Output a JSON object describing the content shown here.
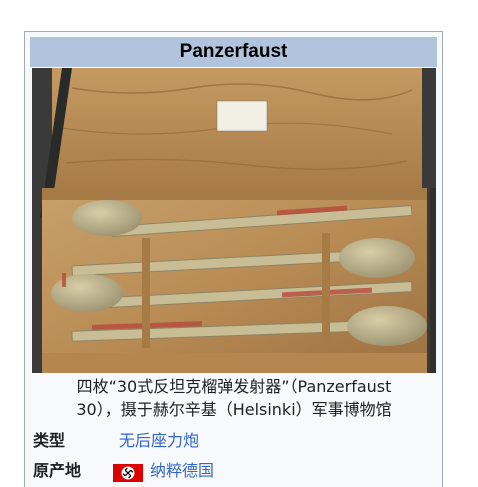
{
  "infobox": {
    "title": "Panzerfaust",
    "caption_line1": "四枚“30式反坦克榴弹发射器”（Panzerfaust",
    "caption_line2": "30），摄于赫尔辛基（Helsinki）军事博物馆",
    "rows": [
      {
        "label": "类型",
        "value": "无后座力炮"
      },
      {
        "label": "原产地",
        "value": "纳粹德国",
        "flag_icon": "swastika-flag-icon"
      }
    ],
    "colors": {
      "title_bg": "#b0c4de",
      "link": "#3366cc",
      "border": "#a2a9b1"
    }
  }
}
